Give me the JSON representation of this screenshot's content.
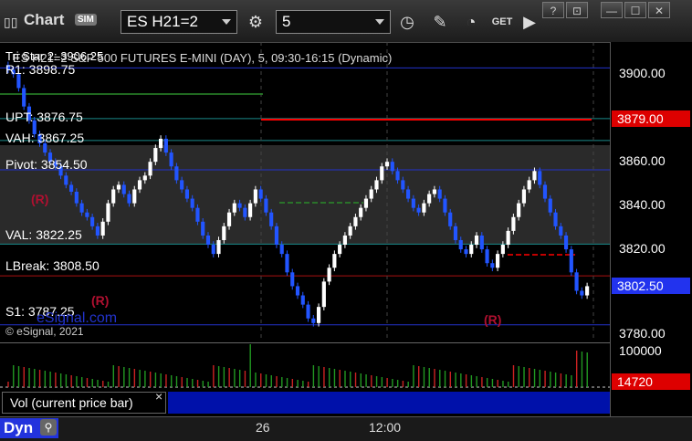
{
  "toolbar": {
    "title": "Chart",
    "sim_badge": "SIM",
    "symbol": "ES H21=2",
    "interval": "5",
    "get_label": "GET"
  },
  "window_buttons": [
    "?",
    "⊡",
    "—",
    "☐",
    "✕"
  ],
  "chart": {
    "header_line": "Tri Star 2: 3906.25",
    "header_line2": "ES H21=2 S&P 500 FUTURES E-MINI (DAY), 5, 09:30-16:15 (Dynamic)",
    "levels": [
      {
        "label": "R1: 3898.75",
        "value": 3898.75
      },
      {
        "label": "UPT: 3876.75",
        "value": 3876.75
      },
      {
        "label": "VAH: 3867.25",
        "value": 3867.25
      },
      {
        "label": "Pivot: 3854.50",
        "value": 3854.5
      },
      {
        "label": "VAL: 3822.25",
        "value": 3822.25
      },
      {
        "label": "LBreak: 3808.50",
        "value": 3808.5
      },
      {
        "label": "S1: 3787.25",
        "value": 3787.25
      }
    ],
    "copyright": "© eSignal, 2021",
    "watermark": "eSignal.com",
    "r_markers": [
      "(R)",
      "(R)",
      "(R)"
    ],
    "colors": {
      "up": "#ffffff",
      "down": "#2255ff",
      "red_line": "#ff0000",
      "green_line": "#2a8a2a",
      "blue_line": "#2233cc",
      "teal_line": "#1a8a8a"
    }
  },
  "price_axis": {
    "ticks": [
      "3900.00",
      "3880.00",
      "3860.00",
      "3840.00",
      "3820.00",
      "3800.00",
      "3780.00"
    ],
    "badge_red": "3879.00",
    "badge_blue": "3802.50"
  },
  "volume": {
    "tick": "100000",
    "badge": "14720",
    "label": "Vol (current price bar)",
    "close_glyph": "×"
  },
  "time_axis": {
    "labels": [
      "26",
      "12:00"
    ]
  },
  "bottom": {
    "dyn_label": "Dyn"
  },
  "chart_data": {
    "type": "candlestick",
    "ylim": [
      3780,
      3910
    ],
    "closes": [
      3898,
      3896,
      3890,
      3882,
      3876,
      3870,
      3866,
      3862,
      3858,
      3856,
      3852,
      3848,
      3845,
      3840,
      3836,
      3834,
      3830,
      3826,
      3832,
      3840,
      3846,
      3848,
      3844,
      3840,
      3846,
      3850,
      3852,
      3858,
      3864,
      3868,
      3862,
      3856,
      3850,
      3846,
      3842,
      3838,
      3832,
      3826,
      3822,
      3818,
      3824,
      3830,
      3836,
      3840,
      3838,
      3834,
      3840,
      3846,
      3842,
      3836,
      3830,
      3822,
      3818,
      3810,
      3804,
      3800,
      3796,
      3790,
      3788,
      3795,
      3806,
      3812,
      3818,
      3822,
      3826,
      3830,
      3834,
      3838,
      3842,
      3846,
      3850,
      3856,
      3858,
      3854,
      3850,
      3846,
      3842,
      3838,
      3836,
      3840,
      3844,
      3846,
      3842,
      3836,
      3830,
      3824,
      3820,
      3818,
      3822,
      3826,
      3820,
      3814,
      3812,
      3818,
      3822,
      3828,
      3834,
      3840,
      3846,
      3850,
      3854,
      3848,
      3842,
      3836,
      3830,
      3826,
      3820,
      3810,
      3802,
      3800,
      3804
    ]
  }
}
